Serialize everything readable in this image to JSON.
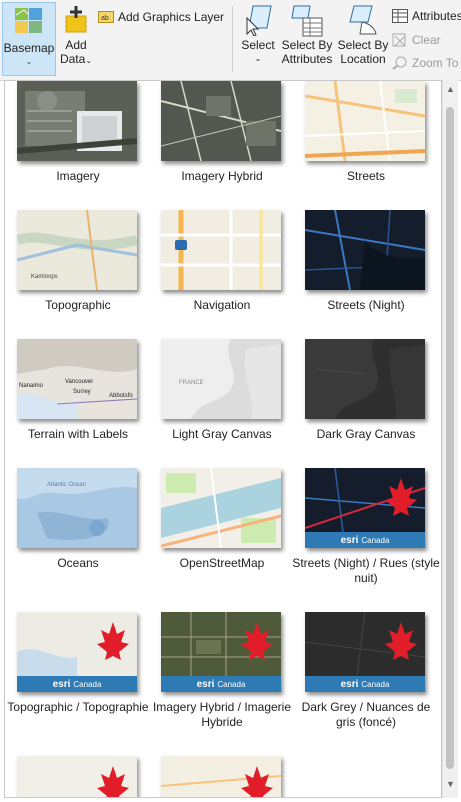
{
  "ribbon": {
    "basemap": "Basemap",
    "add_data_line1": "Add",
    "add_data_line2": "Data",
    "add_graphics_layer": "Add Graphics Layer",
    "select": "Select",
    "select_by_attributes_1": "Select By",
    "select_by_attributes_2": "Attributes",
    "select_by_location_1": "Select By",
    "select_by_location_2": "Location",
    "attributes": "Attributes",
    "clear": "Clear",
    "zoom_to": "Zoom To"
  },
  "basemaps": [
    {
      "label": "Imagery"
    },
    {
      "label": "Imagery Hybrid"
    },
    {
      "label": "Streets"
    },
    {
      "label": "Topographic"
    },
    {
      "label": "Navigation"
    },
    {
      "label": "Streets (Night)"
    },
    {
      "label": "Terrain with Labels"
    },
    {
      "label": "Light Gray Canvas"
    },
    {
      "label": "Dark Gray Canvas"
    },
    {
      "label": "Oceans"
    },
    {
      "label": "OpenStreetMap"
    },
    {
      "label": "Streets (Night) / Rues (style nuit)"
    },
    {
      "label": "Topographic / Topographie"
    },
    {
      "label": "Imagery Hybrid / Imagerie Hybride"
    },
    {
      "label": "Dark Grey / Nuances de gris (foncé)"
    }
  ],
  "esri_badge": {
    "brand": "esri",
    "country": "Canada"
  },
  "map_text": {
    "terrain": [
      "Nanaimo",
      "Vancouver",
      "Surrey",
      "Abbotsfo"
    ],
    "topo": [
      "Kamloops"
    ],
    "light_gray": [
      "FRANCE"
    ],
    "oceans": [
      "Atlantic Ocean"
    ]
  }
}
